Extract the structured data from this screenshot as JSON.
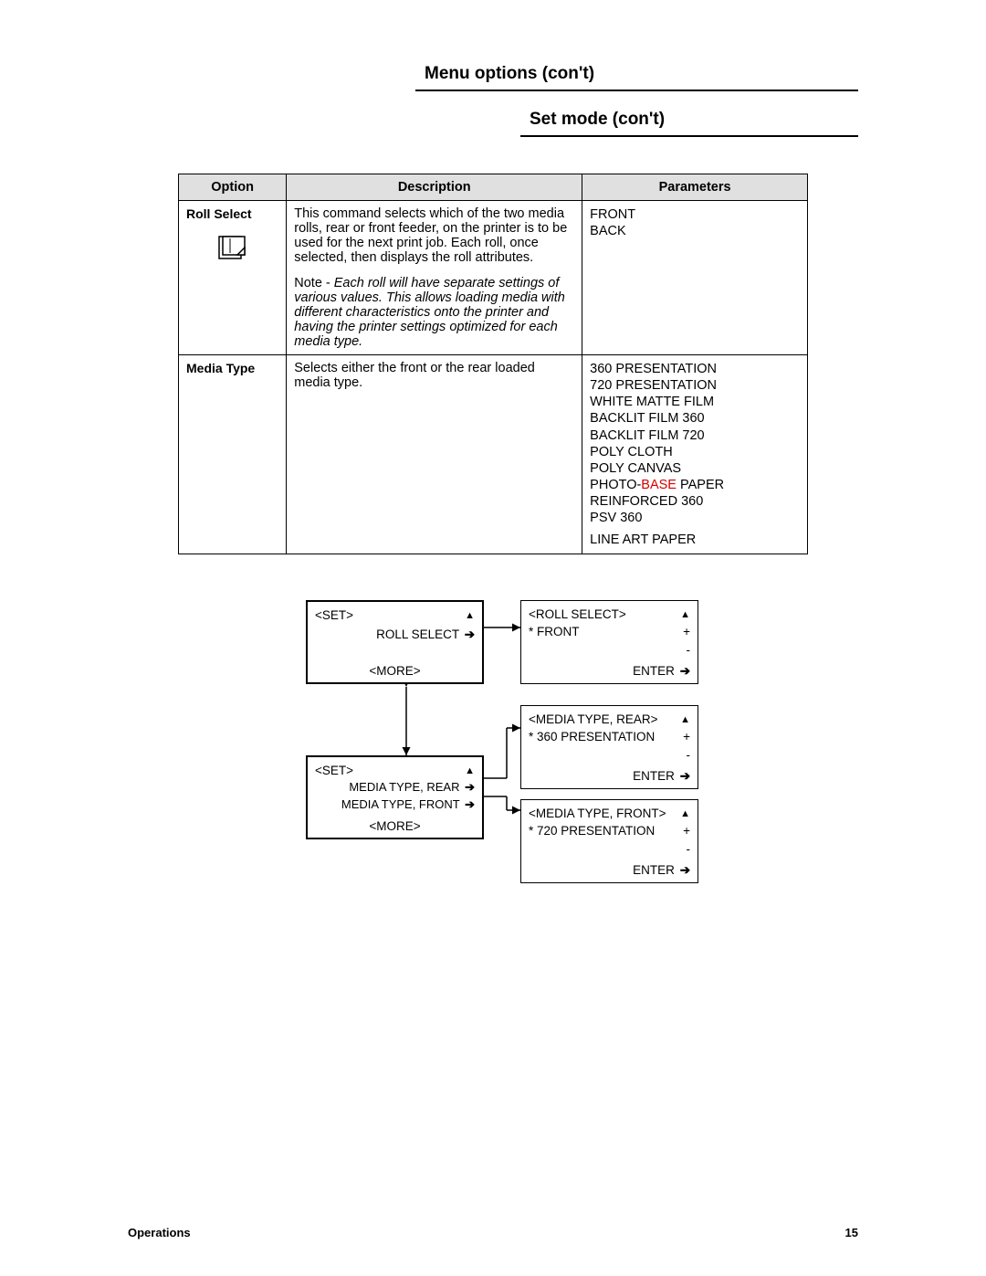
{
  "titles": {
    "menu_options": "Menu options (con't)",
    "set_mode": "Set mode (con't)"
  },
  "table": {
    "headers": {
      "option": "Option",
      "description": "Description",
      "parameters": "Parameters"
    },
    "rows": [
      {
        "option": "Roll Select",
        "description": "This command selects which of the two media rolls, rear or front feeder, on the printer is to be used for the next print job. Each roll, once selected, then displays the roll attributes.",
        "note_prefix": "Note  -  ",
        "note": "Each roll will have separate settings of various values. This allows loading media with different characteristics onto the printer and having the printer settings optimized for each media type.",
        "parameters": [
          "FRONT",
          "BACK"
        ]
      },
      {
        "option": "Media Type",
        "description": "Selects either the front or the rear loaded media type.",
        "parameters_pre_base": [
          "360 PRESENTATION",
          "720 PRESENTATION",
          "WHITE MATTE FILM",
          "BACKLIT FILM 360",
          "BACKLIT FILM 720",
          "POLY CLOTH",
          "POLY CANVAS"
        ],
        "param_photo_pre": "PHOTO-",
        "param_photo_base": "BASE",
        "param_photo_post": " PAPER",
        "parameters_post_base": [
          "REINFORCED 360",
          "PSV 360"
        ],
        "param_last": "LINE ART PAPER"
      }
    ]
  },
  "diagram": {
    "boxA": {
      "l1": "<SET>",
      "l2": "ROLL SELECT",
      "l3": "<MORE>"
    },
    "boxB": {
      "l1": "<ROLL SELECT>",
      "l2": "*  FRONT",
      "plus": "+",
      "minus": "-",
      "enter": "ENTER"
    },
    "boxC": {
      "l1": "<MEDIA TYPE, REAR>",
      "l2": "*  360 PRESENTATION",
      "plus": "+",
      "minus": "-",
      "enter": "ENTER"
    },
    "boxD": {
      "l1": "<SET>",
      "l2a": "MEDIA TYPE, REAR",
      "l2b": "MEDIA TYPE, FRONT",
      "l3": "<MORE>"
    },
    "boxE": {
      "l1": "<MEDIA TYPE, FRONT>",
      "l2": "*  720 PRESENTATION",
      "plus": "+",
      "minus": "-",
      "enter": "ENTER"
    }
  },
  "footer": {
    "section": "Operations",
    "page": "15"
  }
}
